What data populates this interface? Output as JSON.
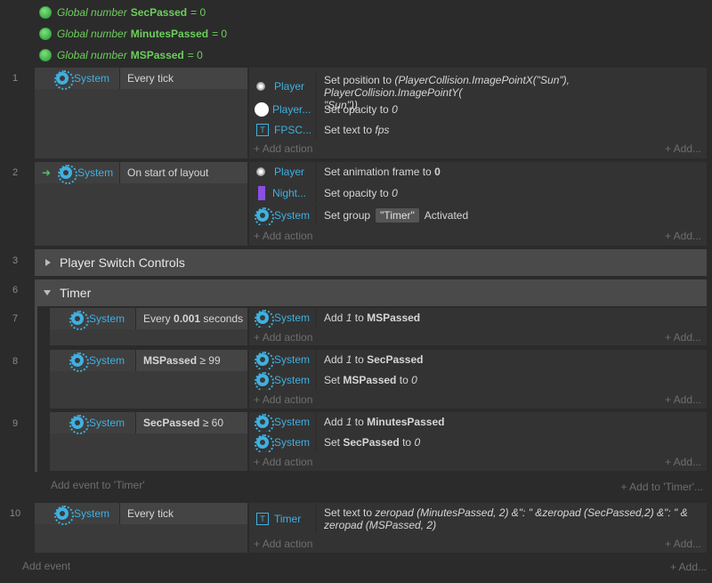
{
  "globals": [
    {
      "prefix": "Global number",
      "name": "SecPassed",
      "value": "= 0"
    },
    {
      "prefix": "Global number",
      "name": "MinutesPassed",
      "value": "= 0"
    },
    {
      "prefix": "Global number",
      "name": "MSPassed",
      "value": "= 0"
    }
  ],
  "common": {
    "system": "System",
    "add_action": "Add action",
    "add_more": "Add..."
  },
  "e1": {
    "num": "1",
    "cond": "Every tick",
    "a1_obj": "Player",
    "a1_desc_pre": "Set position to ",
    "a1_desc_expr": "(PlayerCollision.ImagePointX(\"Sun\"), PlayerCollision.ImagePointY(",
    "a1_desc_expr2": "\"Sun\"))",
    "a2_obj": "Player...",
    "a2_desc": "Set opacity to",
    "a2_val": "0",
    "a3_obj": "FPSC...",
    "a3_desc": "Set text to",
    "a3_val": "fps"
  },
  "e2": {
    "num": "2",
    "cond": "On start of layout",
    "a1_obj": "Player",
    "a1_desc": "Set animation frame to",
    "a1_val": "0",
    "a2_obj": "Night...",
    "a2_desc": "Set opacity to",
    "a2_val": "0",
    "a3_desc": "Set group",
    "a3_tag": "\"Timer\"",
    "a3_after": "Activated"
  },
  "g3": {
    "num": "3",
    "title": "Player Switch Controls"
  },
  "g6": {
    "num": "6",
    "title": "Timer"
  },
  "e7": {
    "num": "7",
    "cond_pre": "Every",
    "cond_bold": "0.001",
    "cond_post": "seconds",
    "a1_pre": "Add",
    "a1_val": "1",
    "a1_to": "to",
    "a1_var": "MSPassed"
  },
  "e8": {
    "num": "8",
    "cond_bold": "MSPassed",
    "cond_post": "≥ 99",
    "a1_pre": "Add",
    "a1_val": "1",
    "a1_to": "to",
    "a1_var": "SecPassed",
    "a2_pre": "Set",
    "a2_var": "MSPassed",
    "a2_to": "to",
    "a2_val": "0"
  },
  "e9": {
    "num": "9",
    "cond_bold": "SecPassed",
    "cond_post": "≥ 60",
    "a1_pre": "Add",
    "a1_val": "1",
    "a1_to": "to",
    "a1_var": "MinutesPassed",
    "a2_pre": "Set",
    "a2_var": "SecPassed",
    "a2_to": "to",
    "a2_val": "0"
  },
  "timer_footer": {
    "add_event": "Add event to 'Timer'",
    "add_to": "Add to 'Timer'..."
  },
  "e10": {
    "num": "10",
    "cond": "Every tick",
    "a1_obj": "Timer",
    "a1_pre": "Set text to",
    "a1_expr": "zeropad (MinutesPassed, 2) &\": \" &zeropad (SecPassed,2) &\": \" &",
    "a1_expr2": "zeropad (MSPassed, 2)"
  },
  "footer": {
    "add_event": "Add event",
    "add_more": "Add..."
  }
}
